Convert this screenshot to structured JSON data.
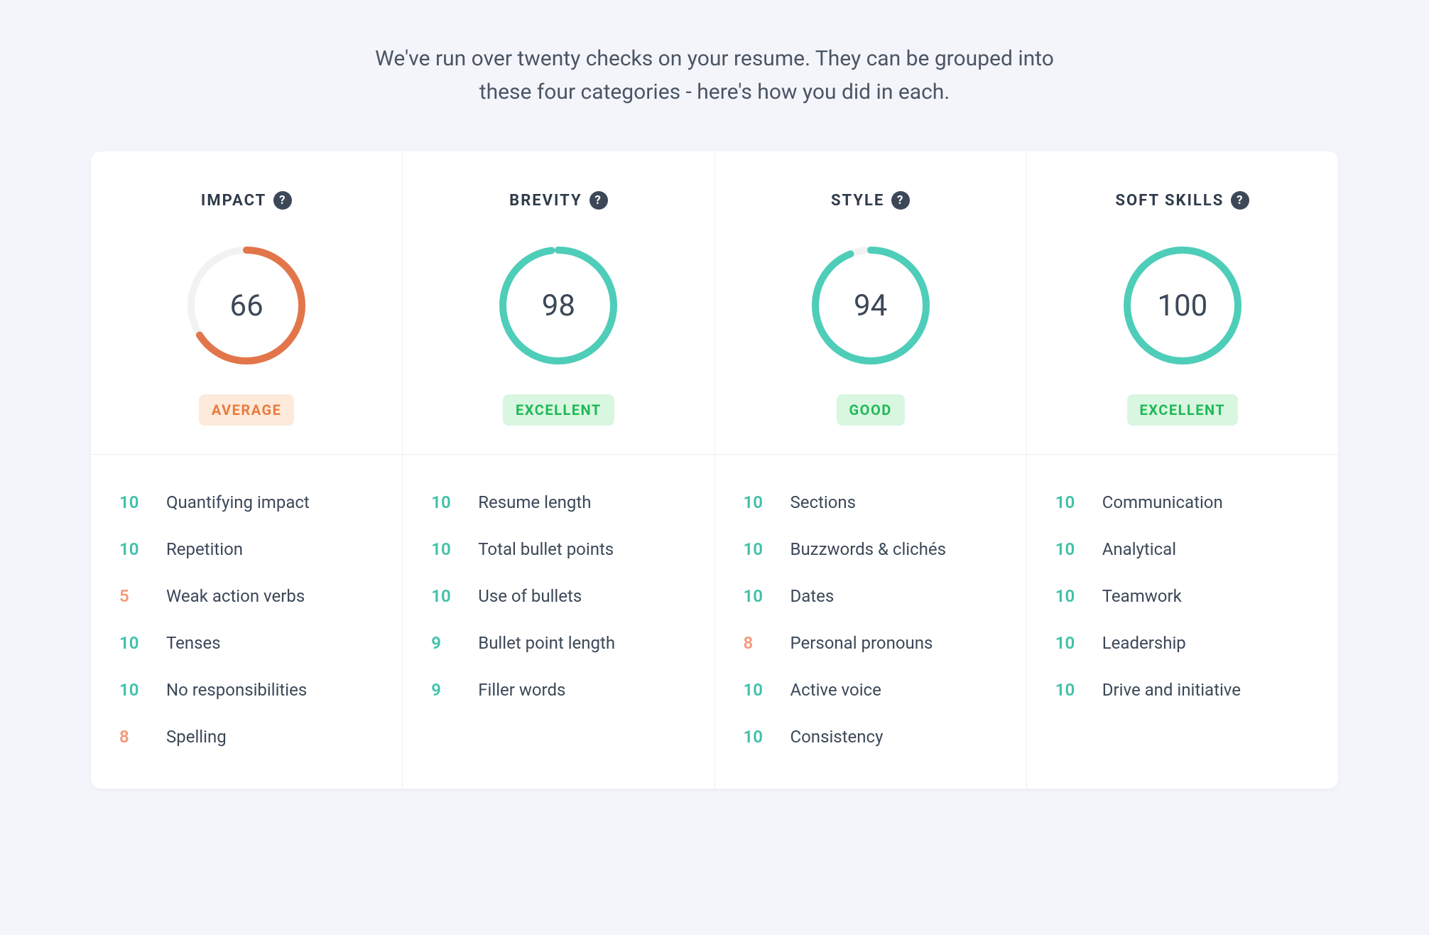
{
  "intro": "We've run over twenty checks on your resume. They can be grouped into these four categories - here's how you did in each.",
  "colors": {
    "ring_orange": "#e2764a",
    "ring_teal": "#4ecdb9",
    "track": "#f2f2f2"
  },
  "categories": [
    {
      "title": "IMPACT",
      "score": 66,
      "ring_color": "orange",
      "badge": {
        "text": "AVERAGE",
        "style": "orange"
      },
      "items": [
        {
          "score": 10,
          "tone": "teal",
          "label": "Quantifying impact"
        },
        {
          "score": 10,
          "tone": "teal",
          "label": "Repetition"
        },
        {
          "score": 5,
          "tone": "salmon",
          "label": "Weak action verbs"
        },
        {
          "score": 10,
          "tone": "teal",
          "label": "Tenses"
        },
        {
          "score": 10,
          "tone": "teal",
          "label": "No responsibilities"
        },
        {
          "score": 8,
          "tone": "salmon",
          "label": "Spelling"
        }
      ]
    },
    {
      "title": "BREVITY",
      "score": 98,
      "ring_color": "teal",
      "badge": {
        "text": "EXCELLENT",
        "style": "green"
      },
      "items": [
        {
          "score": 10,
          "tone": "teal",
          "label": "Resume length"
        },
        {
          "score": 10,
          "tone": "teal",
          "label": "Total bullet points"
        },
        {
          "score": 10,
          "tone": "teal",
          "label": "Use of bullets"
        },
        {
          "score": 9,
          "tone": "teal",
          "label": "Bullet point length"
        },
        {
          "score": 9,
          "tone": "teal",
          "label": "Filler words"
        }
      ]
    },
    {
      "title": "STYLE",
      "score": 94,
      "ring_color": "teal",
      "badge": {
        "text": "GOOD",
        "style": "green"
      },
      "items": [
        {
          "score": 10,
          "tone": "teal",
          "label": "Sections"
        },
        {
          "score": 10,
          "tone": "teal",
          "label": "Buzzwords & clichés"
        },
        {
          "score": 10,
          "tone": "teal",
          "label": "Dates"
        },
        {
          "score": 8,
          "tone": "salmon",
          "label": "Personal pronouns"
        },
        {
          "score": 10,
          "tone": "teal",
          "label": "Active voice"
        },
        {
          "score": 10,
          "tone": "teal",
          "label": "Consistency"
        }
      ]
    },
    {
      "title": "SOFT SKILLS",
      "score": 100,
      "ring_color": "teal",
      "badge": {
        "text": "EXCELLENT",
        "style": "green"
      },
      "items": [
        {
          "score": 10,
          "tone": "teal",
          "label": "Communication"
        },
        {
          "score": 10,
          "tone": "teal",
          "label": "Analytical"
        },
        {
          "score": 10,
          "tone": "teal",
          "label": "Teamwork"
        },
        {
          "score": 10,
          "tone": "teal",
          "label": "Leadership"
        },
        {
          "score": 10,
          "tone": "teal",
          "label": "Drive and initiative"
        }
      ]
    }
  ]
}
